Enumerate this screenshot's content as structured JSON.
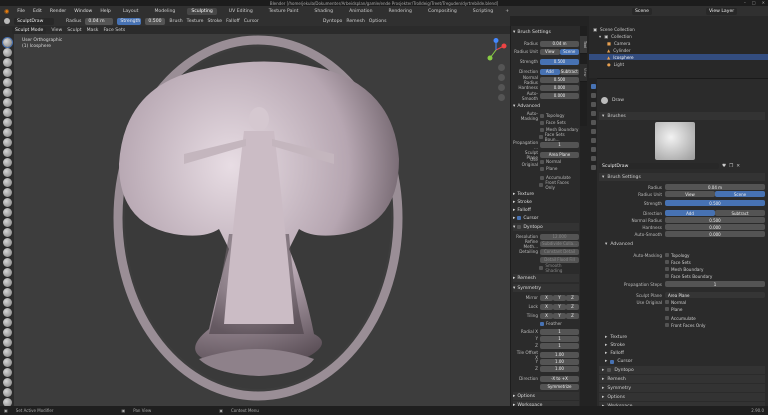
{
  "title": "Blender [/home/jekula/Dokumenter/Arbeidsplan/gamle/ende Prosjekter/Trolldeig/Treet/Treguden/dyrtrebilde.blend]",
  "menu": [
    "File",
    "Edit",
    "Render",
    "Window",
    "Help"
  ],
  "workspaces": [
    "Layout",
    "Modeling",
    "Sculpting",
    "UV Editing",
    "Texture Paint",
    "Shading",
    "Animation",
    "Rendering",
    "Compositing",
    "Scripting"
  ],
  "active_workspace": "Sculpting",
  "scene": "Scene",
  "view_layer": "View Layer",
  "tool_header": {
    "brush": "SculptDraw",
    "radius_label": "Radius",
    "radius": "0.04 m",
    "strength_label": "Strength",
    "strength": "0.500",
    "brush_menu": "Brush",
    "texture_menu": "Texture",
    "stroke_menu": "Stroke",
    "falloff_menu": "Falloff",
    "cursor_menu": "Cursor",
    "dyntopo": "Dyntopo",
    "remesh": "Remesh",
    "options": "Options"
  },
  "vp_header": {
    "mode": "Sculpt Mode",
    "view": "View",
    "sculpt": "Sculpt",
    "mask": "Mask",
    "face_sets": "Face Sets"
  },
  "viewport": {
    "view_name": "User Orthographic",
    "object": "(1) Icosphere"
  },
  "n_panel": {
    "brush_settings": "Brush Settings",
    "radius_label": "Radius",
    "radius": "0.04 m",
    "radius_unit_label": "Radius Unit",
    "view": "View",
    "scene": "Scene",
    "strength_label": "Strength",
    "strength": "0.500",
    "direction_label": "Direction",
    "add": "Add",
    "subtract": "Subtract",
    "normal_radius_label": "Normal Radius",
    "normal_radius": "0.500",
    "hardness_label": "Hardness",
    "hardness": "0.000",
    "autosmooth_label": "Auto-Smooth",
    "autosmooth": "0.000",
    "advanced": "Advanced",
    "automasking_label": "Auto-Masking",
    "topology": "Topology",
    "face_sets": "Face Sets",
    "mesh_boundary": "Mesh Boundary",
    "face_sets_boundary": "Face Sets Boun...",
    "propagation_label": "Propagation ...",
    "propagation": "1",
    "sculpt_plane_label": "Sculpt Plane",
    "sculpt_plane": "Area Plane",
    "use_original_label": "Use Original",
    "normal": "Normal",
    "plane": "Plane",
    "accumulate": "Accumulate",
    "front_faces_only": "Front Faces Only",
    "texture": "Texture",
    "stroke": "Stroke",
    "falloff": "Falloff",
    "cursor": "Cursor",
    "dyntopo": "Dyntopo",
    "resolution_label": "Resolution",
    "resolution": "12.000",
    "refine_method_label": "Refine Meth...",
    "refine_method": "Subdivide Colla...",
    "detailing_label": "Detailing",
    "detailing": "Constant Detail",
    "detail_flood": "Detail Flood Fill",
    "smooth_shading": "Smooth Shading",
    "remesh": "Remesh",
    "symmetry": "Symmetry",
    "mirror_label": "Mirror",
    "lock_label": "Lock",
    "tiling_label": "Tiling",
    "x": "X",
    "y": "Y",
    "z": "Z",
    "feather": "Feather",
    "radial_x_label": "Radial X",
    "radial_y": "Y",
    "radial_z": "Z",
    "one": "1",
    "tile_offset_x_label": "Tile Offset X",
    "tile_val": "1.00",
    "direction2_label": "Direction",
    "direction2": "-X to +X",
    "symmetrize": "Symmetrize",
    "options": "Options",
    "workspace": "Workspace"
  },
  "tabs": [
    "Tool",
    "View"
  ],
  "outliner": {
    "scene_collection": "Scene Collection",
    "items": [
      "Collection",
      "Camera",
      "Cylinder",
      "Icosphere",
      "Light"
    ]
  },
  "properties": {
    "draw": "Draw",
    "brushes": "Brushes",
    "brush_name": "SculptDraw",
    "brush_settings": "Brush Settings",
    "radius_label": "Radius",
    "radius": "0.04 m",
    "radius_unit_label": "Radius Unit",
    "view": "View",
    "scene": "Scene",
    "strength_label": "Strength",
    "strength": "0.500",
    "direction_label": "Direction",
    "add": "Add",
    "subtract": "Subtract",
    "normal_radius_label": "Normal Radius",
    "normal_radius": "0.500",
    "hardness_label": "Hardness",
    "hardness": "0.000",
    "autosmooth_label": "Auto-Smooth",
    "autosmooth": "0.000",
    "advanced": "Advanced",
    "automasking_label": "Auto-Masking",
    "topology": "Topology",
    "face_sets": "Face Sets",
    "mesh_boundary": "Mesh Boundary",
    "face_sets_boundary": "Face Sets Boundary",
    "propagation_label": "Propagation Steps",
    "propagation": "1",
    "sculpt_plane_label": "Sculpt Plane",
    "sculpt_plane": "Area Plane",
    "use_original_label": "Use Original",
    "normal": "Normal",
    "plane": "Plane",
    "accumulate": "Accumulate",
    "front_faces_only": "Front Faces Only",
    "texture": "Texture",
    "stroke": "Stroke",
    "falloff": "Falloff",
    "cursor": "Cursor",
    "dyntopo": "Dyntopo",
    "remesh": "Remesh",
    "symmetry": "Symmetry",
    "options": "Options",
    "workspace": "Workspace"
  },
  "status": {
    "left": "Set Active Modifier",
    "mid": "Pan View",
    "right": "Context Menu",
    "version": "2.90.0"
  },
  "colors": {
    "accent": "#4772b3",
    "panel": "#2b2b2b",
    "viewport": "#3d3d3d",
    "sculpt": "#b6a6b1"
  }
}
